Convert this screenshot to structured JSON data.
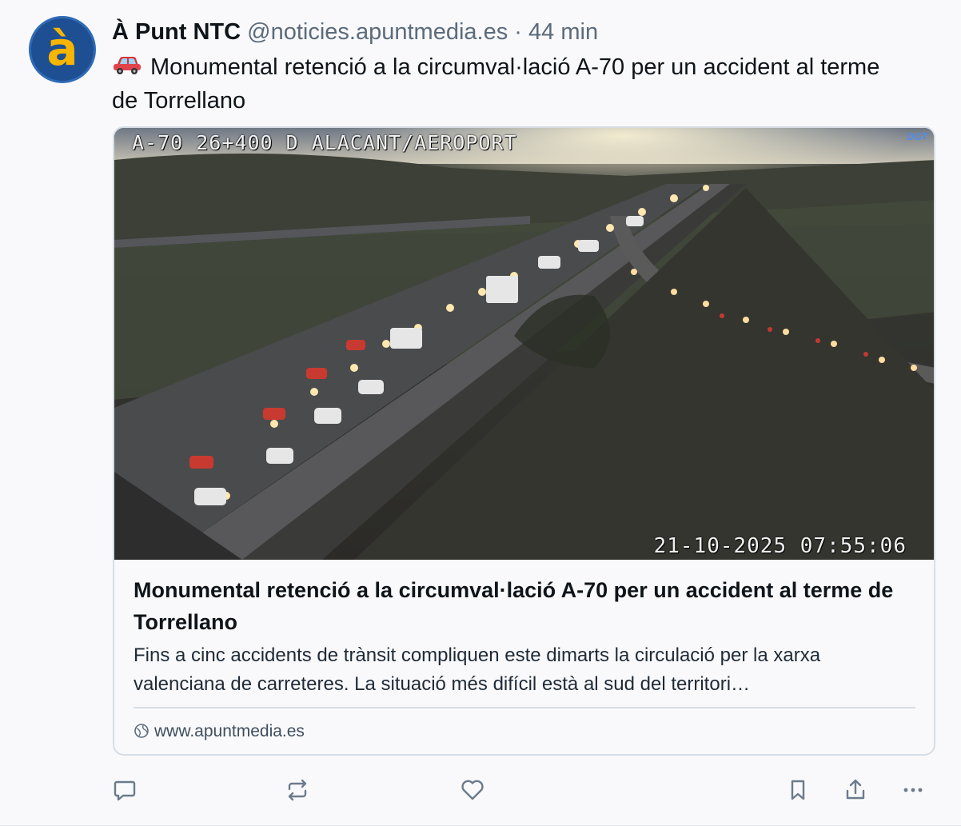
{
  "post": {
    "author_name": "À Punt NTC",
    "handle": "@noticies.apuntmedia.es",
    "separator": "·",
    "time": "44 min",
    "avatar_letter": "à",
    "emoji": "car-emoji",
    "text": "Monumental retenció a la circumval·lació A-70 per un accident al terme de Torrellano"
  },
  "card": {
    "camera_overlay_top": "A-70 26+400 D ALACANT/AEROPORT",
    "camera_logo": "DGT",
    "camera_timestamp": "21-10-2025 07:55:06",
    "title": "Monumental retenció a la circumval·lació A-70 per un accident al terme de Torrellano",
    "description": "Fins a cinc accidents de trànsit compliquen este dimarts la circulació per la xarxa valenciana de carreteres. La situació més difícil està al sud del territori…",
    "domain": "www.apuntmedia.es"
  },
  "actions": [
    {
      "icon": "reply-icon"
    },
    {
      "icon": "repost-icon"
    },
    {
      "icon": "like-icon"
    },
    {
      "icon": "bookmark-icon"
    },
    {
      "icon": "share-icon"
    },
    {
      "icon": "more-icon"
    }
  ],
  "colors": {
    "background": "#f9f9fb",
    "muted_text": "#5b6b7c",
    "avatar_blue": "#1e4f93",
    "avatar_yellow": "#f7b500",
    "icon_gray": "#6b7b8c"
  }
}
